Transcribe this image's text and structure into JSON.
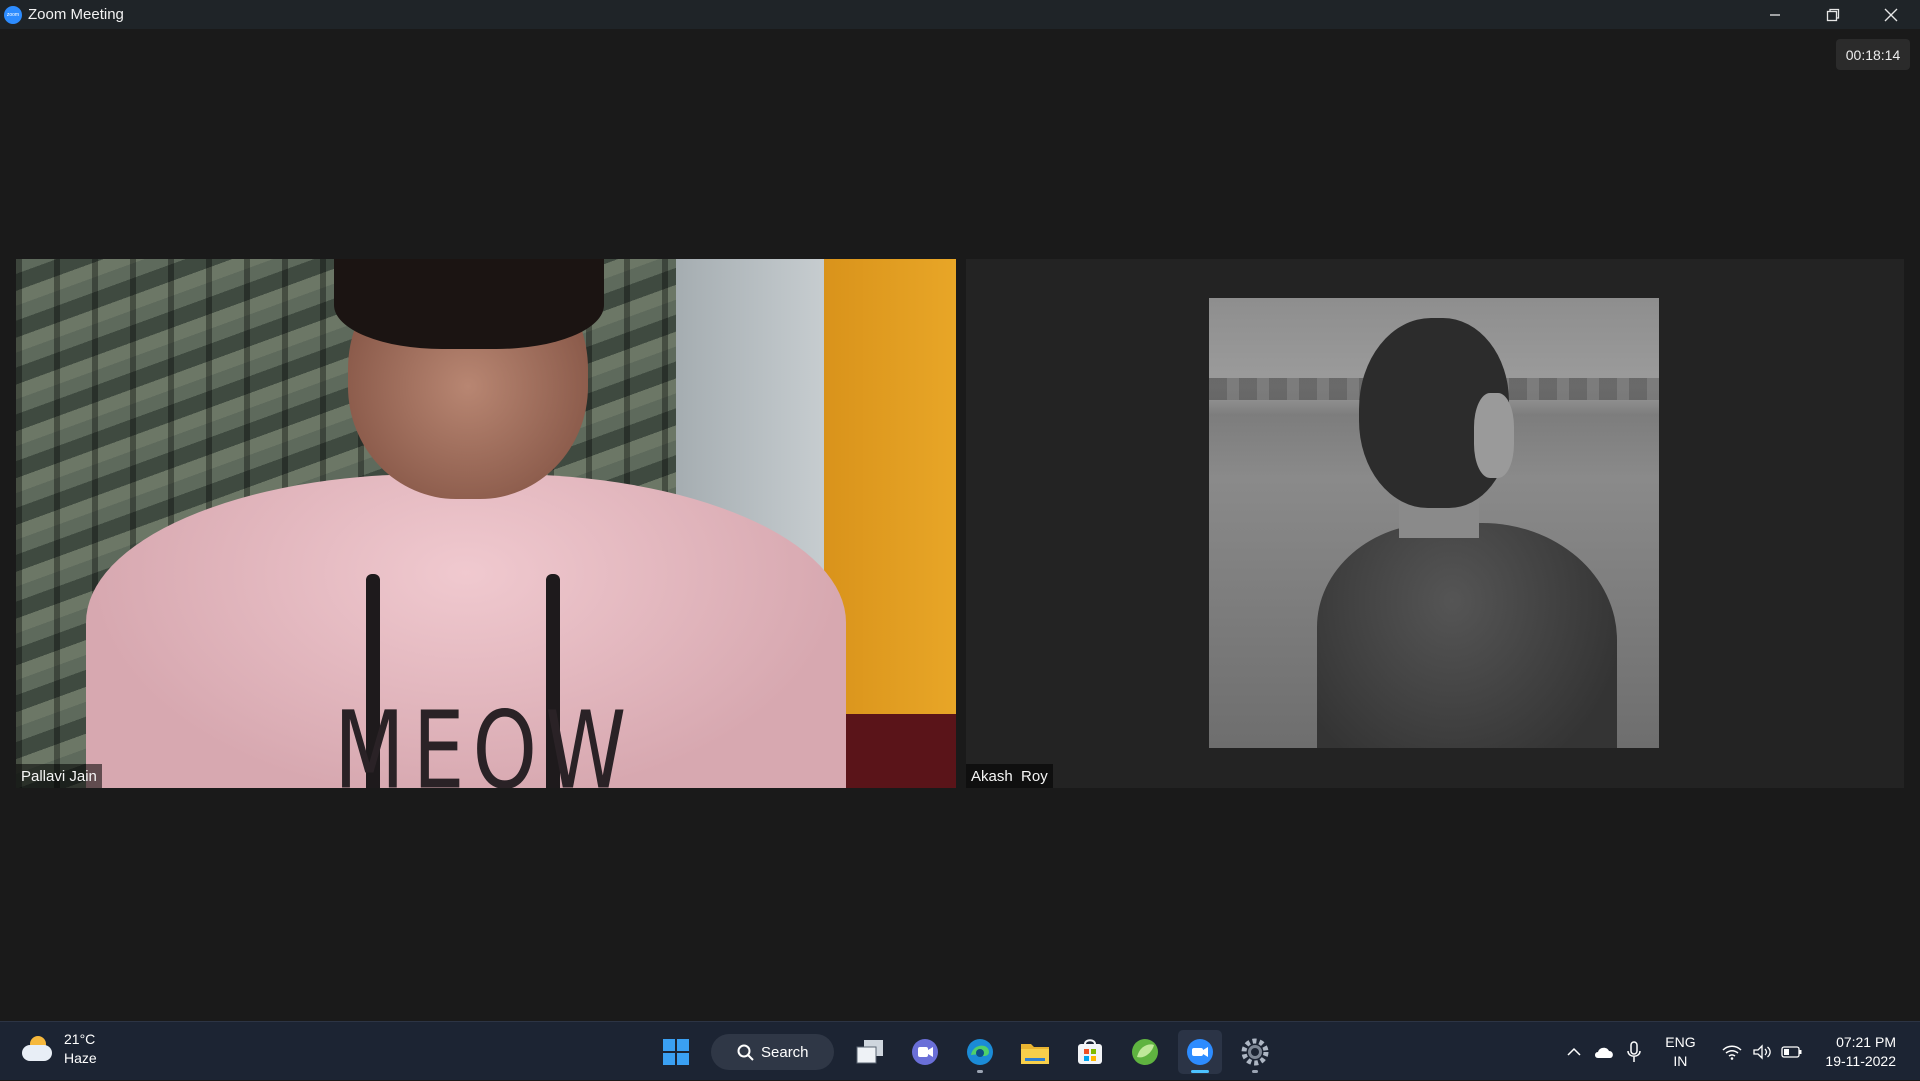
{
  "window": {
    "title": "Zoom Meeting",
    "logo_text": "zoom"
  },
  "meeting": {
    "timer": "00:18:14",
    "participants": [
      {
        "name": "Pallavi Jain",
        "print_text": "MEOW"
      },
      {
        "name": "Akash  Roy"
      }
    ]
  },
  "taskbar": {
    "weather": {
      "temp": "21°C",
      "condition": "Haze"
    },
    "search_label": "Search",
    "apps": [
      "start-icon",
      "search",
      "task-view-icon",
      "chat-icon",
      "edge-icon",
      "file-explorer-icon",
      "store-icon",
      "app-green-icon",
      "zoom-icon",
      "settings-icon"
    ],
    "tray": {
      "lang_line1": "ENG",
      "lang_line2": "IN",
      "time": "07:21 PM",
      "date": "19-11-2022"
    }
  },
  "colors": {
    "accent": "#2d8cff",
    "taskbar": "#1c2433",
    "active_indicator": "#4cc2ff"
  }
}
